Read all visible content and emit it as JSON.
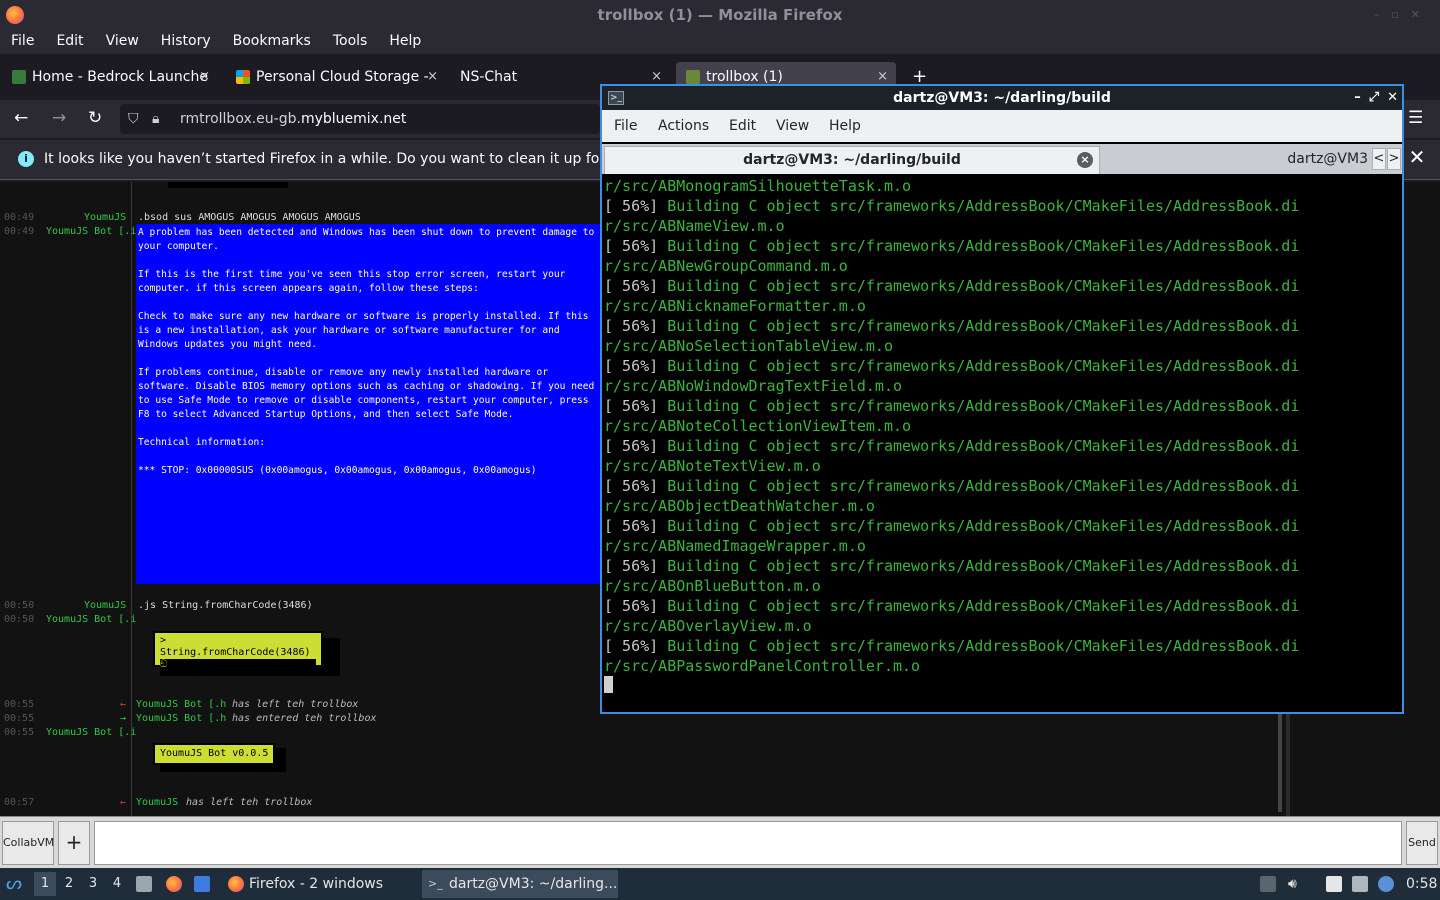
{
  "firefox": {
    "window_title": "trollbox (1) — Mozilla Firefox",
    "menu": [
      "File",
      "Edit",
      "View",
      "History",
      "Bookmarks",
      "Tools",
      "Help"
    ],
    "tabs": [
      {
        "label": "Home - Bedrock Launche",
        "close": "×"
      },
      {
        "label": "Personal Cloud Storage -",
        "close": "×"
      },
      {
        "label": "NS-Chat",
        "close": "×"
      },
      {
        "label": "trollbox (1)",
        "close": "×"
      }
    ],
    "new_tab": "+",
    "url_prefix": "rmtrollbox.eu-gb.",
    "url_domain": "mybluemix.net",
    "notice": "It looks like you haven’t started Firefox in a while. Do you want to clean it up for a f",
    "notice_icon": "i",
    "menu_icon": "☰"
  },
  "trollbox": {
    "messages": [
      {
        "time": "00:49",
        "nick": "YoumuJS",
        "text": ".bsod sus AMOGUS AMOGUS AMOGUS AMOGUS"
      },
      {
        "time": "00:49",
        "nick": "YoumuJS Bot [.i",
        "text": ""
      },
      {
        "time": "00:50",
        "nick": "YoumuJS",
        "text": ".js String.fromCharCode(3486)"
      },
      {
        "time": "00:50",
        "nick": "YoumuJS Bot [.i",
        "text": ""
      },
      {
        "time": "00:55",
        "arrow": "←",
        "nick": "YoumuJS Bot [.h",
        "text": "has left teh trollbox"
      },
      {
        "time": "00:55",
        "arrow": "→",
        "nick": "YoumuJS Bot [.h",
        "text": "has entered teh trollbox"
      },
      {
        "time": "00:55",
        "nick": "YoumuJS Bot [.i",
        "text": ""
      },
      {
        "time": "00:57",
        "arrow": "←",
        "nick": "YoumuJS",
        "text": "has left teh trollbox"
      }
    ],
    "bsod": "A problem has been detected and Windows has been shut down to prevent damage to\nyour computer.\n\nIf this is the first time you've seen this stop error screen, restart your\ncomputer. if this screen appears again, follow these steps:\n\nCheck to make sure any new hardware or software is properly installed. If this\nis a new installation, ask your hardware or software manufacturer for and\nWindows updates you might need.\n\nIf problems continue, disable or remove any newly installed hardware or\nsoftware. Disable BIOS memory options such as caching or shadowing. If you need\nto use Safe Mode to remove or disable components, restart your computer, press\nF8 to select Advanced Startup Options, and then select Safe Mode.\n\nTechnical information:\n\n*** STOP: 0x00000SUS (0x00amogus, 0x00amogus, 0x00amogus, 0x00amogus)",
    "js_result": "> String.fromCharCode(3486)",
    "js_result2": "ඞ",
    "bot_version": "YoumuJS Bot v0.0.5"
  },
  "collabvm": {
    "button": "CollabVM",
    "plus": "+",
    "send": "Send",
    "input_value": ""
  },
  "terminal": {
    "title": "dartz@VM3: ~/darling/build",
    "menu": [
      "File",
      "Actions",
      "Edit",
      "View",
      "Help"
    ],
    "tab_active": "dartz@VM3: ~/darling/build",
    "tab_inactive": "dartz@VM3",
    "tab_close": "×",
    "arrow_left": "<",
    "arrow_right": ">",
    "close_all": "✕",
    "window_buttons": [
      "–",
      "⤢",
      "✕"
    ],
    "lines": [
      {
        "c": "g",
        "t": "r/src/ABMonogramSilhouetteTask.m.o"
      },
      {
        "c": "wg",
        "p": "[ 56%] ",
        "t": "Building C object src/frameworks/AddressBook/CMakeFiles/AddressBook.di"
      },
      {
        "c": "g",
        "t": "r/src/ABNameView.m.o"
      },
      {
        "c": "wg",
        "p": "[ 56%] ",
        "t": "Building C object src/frameworks/AddressBook/CMakeFiles/AddressBook.di"
      },
      {
        "c": "g",
        "t": "r/src/ABNewGroupCommand.m.o"
      },
      {
        "c": "wg",
        "p": "[ 56%] ",
        "t": "Building C object src/frameworks/AddressBook/CMakeFiles/AddressBook.di"
      },
      {
        "c": "g",
        "t": "r/src/ABNicknameFormatter.m.o"
      },
      {
        "c": "wg",
        "p": "[ 56%] ",
        "t": "Building C object src/frameworks/AddressBook/CMakeFiles/AddressBook.di"
      },
      {
        "c": "g",
        "t": "r/src/ABNoSelectionTableView.m.o"
      },
      {
        "c": "wg",
        "p": "[ 56%] ",
        "t": "Building C object src/frameworks/AddressBook/CMakeFiles/AddressBook.di"
      },
      {
        "c": "g",
        "t": "r/src/ABNoWindowDragTextField.m.o"
      },
      {
        "c": "wg",
        "p": "[ 56%] ",
        "t": "Building C object src/frameworks/AddressBook/CMakeFiles/AddressBook.di"
      },
      {
        "c": "g",
        "t": "r/src/ABNoteCollectionViewItem.m.o"
      },
      {
        "c": "wg",
        "p": "[ 56%] ",
        "t": "Building C object src/frameworks/AddressBook/CMakeFiles/AddressBook.di"
      },
      {
        "c": "g",
        "t": "r/src/ABNoteTextView.m.o"
      },
      {
        "c": "wg",
        "p": "[ 56%] ",
        "t": "Building C object src/frameworks/AddressBook/CMakeFiles/AddressBook.di"
      },
      {
        "c": "g",
        "t": "r/src/ABObjectDeathWatcher.m.o"
      },
      {
        "c": "wg",
        "p": "[ 56%] ",
        "t": "Building C object src/frameworks/AddressBook/CMakeFiles/AddressBook.di"
      },
      {
        "c": "g",
        "t": "r/src/ABNamedImageWrapper.m.o"
      },
      {
        "c": "wg",
        "p": "[ 56%] ",
        "t": "Building C object src/frameworks/AddressBook/CMakeFiles/AddressBook.di"
      },
      {
        "c": "g",
        "t": "r/src/ABOnBlueButton.m.o"
      },
      {
        "c": "wg",
        "p": "[ 56%] ",
        "t": "Building C object src/frameworks/AddressBook/CMakeFiles/AddressBook.di"
      },
      {
        "c": "g",
        "t": "r/src/ABOverlayView.m.o"
      },
      {
        "c": "wg",
        "p": "[ 56%] ",
        "t": "Building C object src/frameworks/AddressBook/CMakeFiles/AddressBook.di"
      },
      {
        "c": "g",
        "t": "r/src/ABPasswordPanelController.m.o"
      }
    ]
  },
  "taskbar": {
    "workspaces": [
      "1",
      "2",
      "3",
      "4"
    ],
    "firefox_task": "Firefox - 2 windows",
    "terminal_task": "dartz@VM3: ~/darling...",
    "clock": "0:58"
  },
  "colors": {
    "terminal_green": "#3cb43c",
    "bsod_blue": "#0000ff",
    "terminal_border": "#3d8ee6",
    "bot_box": "#ccdd33"
  }
}
